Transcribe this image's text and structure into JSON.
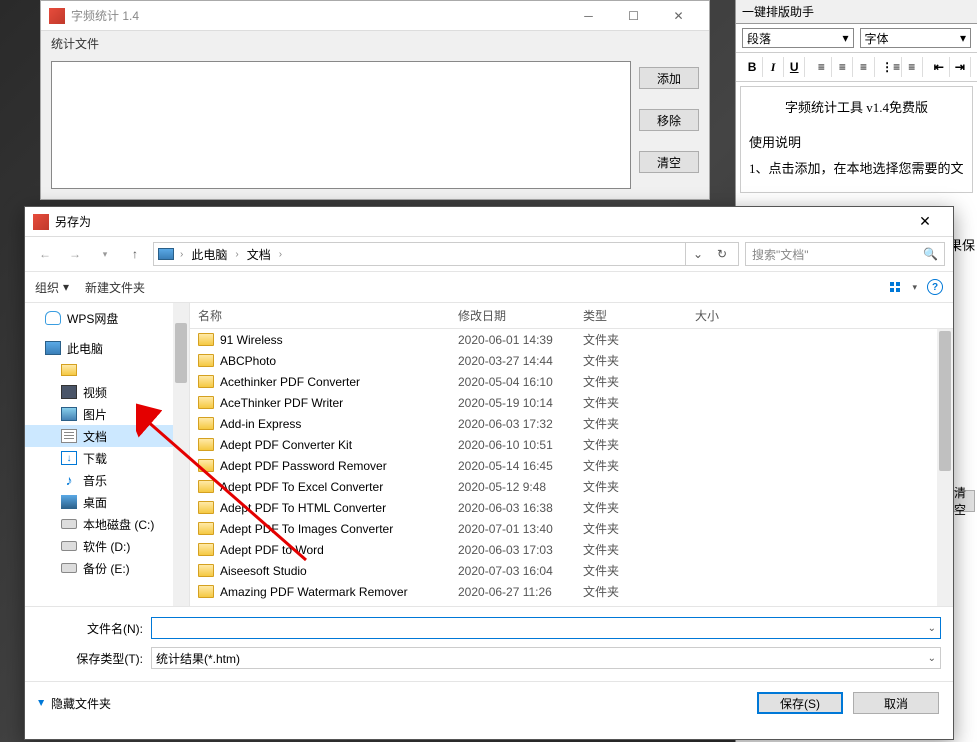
{
  "app": {
    "title": "字频统计 1.4",
    "menu": "统计文件",
    "buttons": {
      "add": "添加",
      "remove": "移除",
      "clear": "清空"
    }
  },
  "sidepanel": {
    "title": "一键排版助手",
    "paragraph": "段落",
    "font": "字体",
    "content_title": "字频统计工具 v1.4免费版",
    "usage_heading": "使用说明",
    "usage_1": "1、点击添加，在本地选择您需要的文",
    "usage_2_partial": "果保",
    "clear_btn": "清空"
  },
  "dialog": {
    "title": "另存为",
    "breadcrumb": {
      "root": "此电脑",
      "folder": "文档"
    },
    "search_placeholder": "搜索\"文档\"",
    "toolbar": {
      "organize": "组织",
      "newfolder": "新建文件夹"
    },
    "headers": {
      "name": "名称",
      "date": "修改日期",
      "type": "类型",
      "size": "大小"
    },
    "tree": {
      "wps": "WPS网盘",
      "thispc": "此电脑",
      "video": "视频",
      "pictures": "图片",
      "documents": "文档",
      "downloads": "下载",
      "music": "音乐",
      "desktop": "桌面",
      "diskc": "本地磁盘 (C:)",
      "diskd": "软件 (D:)",
      "diske": "备份 (E:)"
    },
    "files": [
      {
        "name": "91 Wireless",
        "date": "2020-06-01 14:39",
        "type": "文件夹"
      },
      {
        "name": "ABCPhoto",
        "date": "2020-03-27 14:44",
        "type": "文件夹"
      },
      {
        "name": "Acethinker PDF Converter",
        "date": "2020-05-04 16:10",
        "type": "文件夹"
      },
      {
        "name": "AceThinker PDF Writer",
        "date": "2020-05-19 10:14",
        "type": "文件夹"
      },
      {
        "name": "Add-in Express",
        "date": "2020-06-03 17:32",
        "type": "文件夹"
      },
      {
        "name": "Adept PDF Converter Kit",
        "date": "2020-06-10 10:51",
        "type": "文件夹"
      },
      {
        "name": "Adept PDF Password Remover",
        "date": "2020-05-14 16:45",
        "type": "文件夹"
      },
      {
        "name": "Adept PDF To Excel Converter",
        "date": "2020-05-12 9:48",
        "type": "文件夹"
      },
      {
        "name": "Adept PDF To HTML Converter",
        "date": "2020-06-03 16:38",
        "type": "文件夹"
      },
      {
        "name": "Adept PDF To Images Converter",
        "date": "2020-07-01 13:40",
        "type": "文件夹"
      },
      {
        "name": "Adept PDF to Word",
        "date": "2020-06-03 17:03",
        "type": "文件夹"
      },
      {
        "name": "Aiseesoft Studio",
        "date": "2020-07-03 16:04",
        "type": "文件夹"
      },
      {
        "name": "Amazing PDF Watermark Remover",
        "date": "2020-06-27 11:26",
        "type": "文件夹"
      }
    ],
    "filename_label": "文件名(N):",
    "filetype_label": "保存类型(T):",
    "filetype_value": "统计结果(*.htm)",
    "hide_folders": "隐藏文件夹",
    "save": "保存(S)",
    "cancel": "取消"
  }
}
